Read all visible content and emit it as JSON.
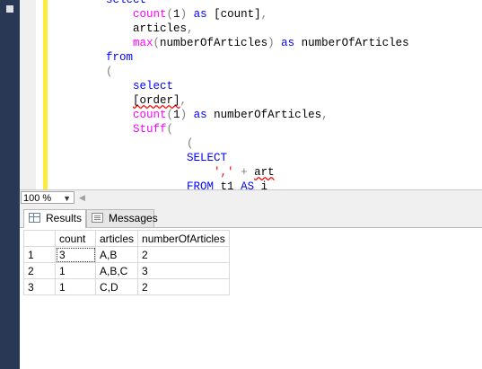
{
  "editor": {
    "lines": [
      [
        {
          "t": "    "
        },
        {
          "t": "select",
          "c": "kw"
        }
      ],
      [
        {
          "t": "        "
        },
        {
          "t": "count",
          "c": "fn"
        },
        {
          "t": "(",
          "c": "op"
        },
        {
          "t": "1"
        },
        {
          "t": ")",
          "c": "op"
        },
        {
          "t": " "
        },
        {
          "t": "as",
          "c": "kw"
        },
        {
          "t": " [count]"
        },
        {
          "t": ",",
          "c": "op"
        }
      ],
      [
        {
          "t": "        articles"
        },
        {
          "t": ",",
          "c": "op"
        }
      ],
      [
        {
          "t": "        "
        },
        {
          "t": "max",
          "c": "fn"
        },
        {
          "t": "(",
          "c": "op"
        },
        {
          "t": "numberOfArticles"
        },
        {
          "t": ")",
          "c": "op"
        },
        {
          "t": " "
        },
        {
          "t": "as",
          "c": "kw"
        },
        {
          "t": " numberOfArticles"
        }
      ],
      [
        {
          "t": "    "
        },
        {
          "t": "from",
          "c": "kw"
        }
      ],
      [
        {
          "t": "    "
        },
        {
          "t": "(",
          "c": "op"
        }
      ],
      [
        {
          "t": "        "
        },
        {
          "t": "select",
          "c": "kw"
        }
      ],
      [
        {
          "t": "        "
        },
        {
          "t": "[order]",
          "c": "squig"
        },
        {
          "t": ",",
          "c": "op"
        }
      ],
      [
        {
          "t": "        "
        },
        {
          "t": "count",
          "c": "fn"
        },
        {
          "t": "(",
          "c": "op"
        },
        {
          "t": "1"
        },
        {
          "t": ")",
          "c": "op"
        },
        {
          "t": " "
        },
        {
          "t": "as",
          "c": "kw"
        },
        {
          "t": " numberOfArticles"
        },
        {
          "t": ",",
          "c": "op"
        }
      ],
      [
        {
          "t": "        "
        },
        {
          "t": "Stuff",
          "c": "fn"
        },
        {
          "t": "(",
          "c": "op"
        }
      ],
      [
        {
          "t": "                "
        },
        {
          "t": "(",
          "c": "op"
        }
      ],
      [
        {
          "t": "                "
        },
        {
          "t": "SELECT",
          "c": "kw"
        }
      ],
      [
        {
          "t": "                    "
        },
        {
          "t": "','",
          "c": "str"
        },
        {
          "t": " "
        },
        {
          "t": "+",
          "c": "op"
        },
        {
          "t": " "
        },
        {
          "t": "art",
          "c": "squig"
        }
      ],
      [
        {
          "t": "                "
        },
        {
          "t": "FROM",
          "c": "kw"
        },
        {
          "t": " t1 "
        },
        {
          "t": "AS",
          "c": "kw"
        },
        {
          "t": " i"
        }
      ]
    ]
  },
  "zoom": {
    "value": "100 %"
  },
  "tabs": [
    {
      "label": "Results",
      "active": true
    },
    {
      "label": "Messages",
      "active": false
    }
  ],
  "grid": {
    "columns": [
      "count",
      "articles",
      "numberOfArticles"
    ],
    "rows": [
      {
        "num": "1",
        "cells": [
          "3",
          "A,B",
          "2"
        ]
      },
      {
        "num": "2",
        "cells": [
          "1",
          "A,B,C",
          "3"
        ]
      },
      {
        "num": "3",
        "cells": [
          "1",
          "C,D",
          "2"
        ]
      }
    ]
  }
}
